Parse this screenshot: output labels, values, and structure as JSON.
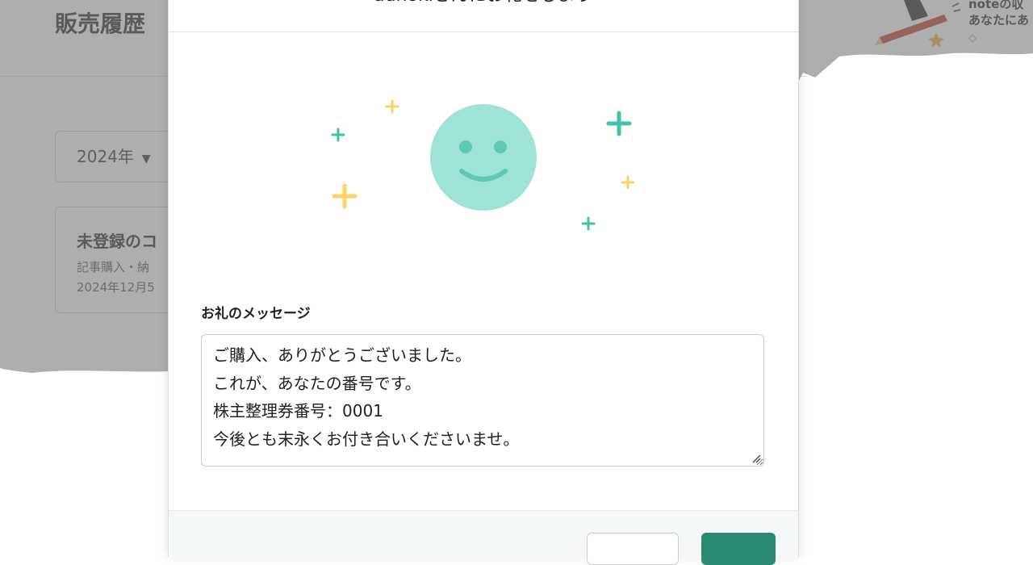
{
  "background": {
    "page_title": "販売履歴",
    "year_select": {
      "value": "2024年"
    },
    "sale_card": {
      "title": "未登録のコ",
      "subtitle": "記事購入・納",
      "date": "2024年12月5"
    },
    "banner": {
      "line1": "noteの収",
      "line2": "あなたにあ",
      "diamond": "◇"
    }
  },
  "modal": {
    "heading": "adnokiさんにお礼をしよう",
    "message_label": "お礼のメッセージ",
    "message_value": "ご購入、ありがとうございました。\nこれが、あなたの番号です。\n株主整理券番号：0001\n今後とも末永くお付き合いくださいませ。",
    "secondary_button": "",
    "primary_button": ""
  },
  "colors": {
    "smiley": "#9ee3d6",
    "teal_sparkle": "#3fc4a8",
    "yellow_sparkle": "#ffd166",
    "overlay": "#8a8a8a",
    "primary_button": "#2a8a72"
  }
}
